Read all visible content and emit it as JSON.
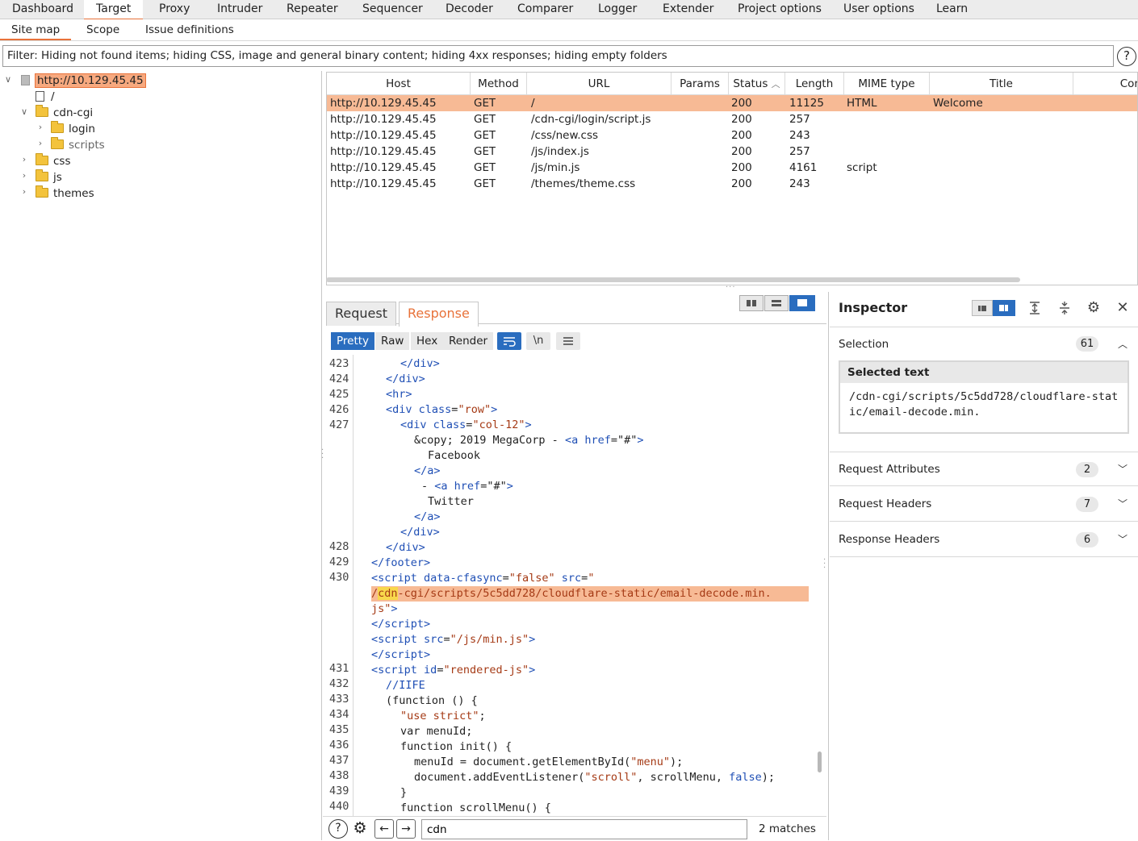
{
  "main_tabs": [
    "Dashboard",
    "Target",
    "Proxy",
    "Intruder",
    "Repeater",
    "Sequencer",
    "Decoder",
    "Comparer",
    "Logger",
    "Extender",
    "Project options",
    "User options",
    "Learn"
  ],
  "sub_tabs": [
    "Site map",
    "Scope",
    "Issue definitions"
  ],
  "filter_text": "Filter: Hiding not found items;  hiding CSS, image and general binary content;  hiding 4xx responses;  hiding empty folders",
  "help_icon": "?",
  "tree": {
    "root": "http://10.129.45.45",
    "slash": "/",
    "cdn_cgi": "cdn-cgi",
    "login": "login",
    "scripts": "scripts",
    "css": "css",
    "js": "js",
    "themes": "themes"
  },
  "table": {
    "headers": [
      "Host",
      "Method",
      "URL",
      "Params",
      "Status",
      "Length",
      "MIME type",
      "Title",
      "Cor"
    ],
    "sort_indicator": "︿",
    "rows": [
      {
        "host": "http://10.129.45.45",
        "method": "GET",
        "url": "/",
        "status": "200",
        "length": "11125",
        "mime": "HTML",
        "title": "Welcome"
      },
      {
        "host": "http://10.129.45.45",
        "method": "GET",
        "url": "/cdn-cgi/login/script.js",
        "status": "200",
        "length": "257",
        "mime": "",
        "title": ""
      },
      {
        "host": "http://10.129.45.45",
        "method": "GET",
        "url": "/css/new.css",
        "status": "200",
        "length": "243",
        "mime": "",
        "title": ""
      },
      {
        "host": "http://10.129.45.45",
        "method": "GET",
        "url": "/js/index.js",
        "status": "200",
        "length": "257",
        "mime": "",
        "title": ""
      },
      {
        "host": "http://10.129.45.45",
        "method": "GET",
        "url": "/js/min.js",
        "status": "200",
        "length": "4161",
        "mime": "script",
        "title": ""
      },
      {
        "host": "http://10.129.45.45",
        "method": "GET",
        "url": "/themes/theme.css",
        "status": "200",
        "length": "243",
        "mime": "",
        "title": ""
      }
    ]
  },
  "req_tabs": {
    "request": "Request",
    "response": "Response"
  },
  "view_tabs": {
    "pretty": "Pretty",
    "raw": "Raw",
    "hex": "Hex",
    "render": "Render",
    "newline": "\\n"
  },
  "code": {
    "line_numbers": {
      "l423": "423",
      "l424": "424",
      "l425": "425",
      "l426": "426",
      "l427": "427",
      "l428": "428",
      "l429": "429",
      "l430": "430",
      "l431": "431",
      "l432": "432",
      "l433": "433",
      "l434": "434",
      "l435": "435",
      "l436": "436",
      "l437": "437",
      "l438": "438",
      "l439": "439",
      "l440": "440"
    },
    "copy_text": "&copy; 2019 MegaCorp - ",
    "facebook": "Facebook",
    "twitter": "Twitter",
    "dash": "- ",
    "hash": "\"#\"",
    "row": "\"row\"",
    "col12": "\"col-12\"",
    "cfasync": "\"false\"",
    "src_open": "\"",
    "src_path_a": "/",
    "src_path_b": "cdn",
    "src_path_c": "-cgi/scripts/5c5dd728/cloudflare-static/email-decode.min.",
    "src_path_d": "js",
    "minjs": "\"/js/min.js\"",
    "rendered": "\"rendered-js\"",
    "iife": "//IIFE",
    "fn_open": "(function () {",
    "use_strict": "\"use strict\"",
    "var_menu": "var menuId;",
    "init": "function init() {",
    "getby_a": "menuId = document.getElementById(",
    "getby_b": "\"menu\"",
    "getby_c": ");",
    "listen_a": "document.addEventListener(",
    "listen_b": "\"scroll\"",
    "listen_c": ", scrollMenu, ",
    "listen_d": "false",
    "listen_e": ");",
    "close_brace": "}",
    "scroll_fn": "function scrollMenu() {"
  },
  "search": {
    "value": "cdn",
    "matches": "2 matches"
  },
  "inspector": {
    "title": "Inspector",
    "selection_label": "Selection",
    "selection_count": "61",
    "selected_text_head": "Selected text",
    "selected_text": "/cdn-cgi/scripts/5c5dd728/cloudflare-static/email-decode.min.",
    "sections": [
      {
        "label": "Request Attributes",
        "count": "2"
      },
      {
        "label": "Request Headers",
        "count": "7"
      },
      {
        "label": "Response Headers",
        "count": "6"
      }
    ]
  },
  "colors": {
    "accent": "#e8723a",
    "selection": "#f7ba95",
    "button_blue": "#2a6dbf",
    "match": "#f8d84b"
  }
}
